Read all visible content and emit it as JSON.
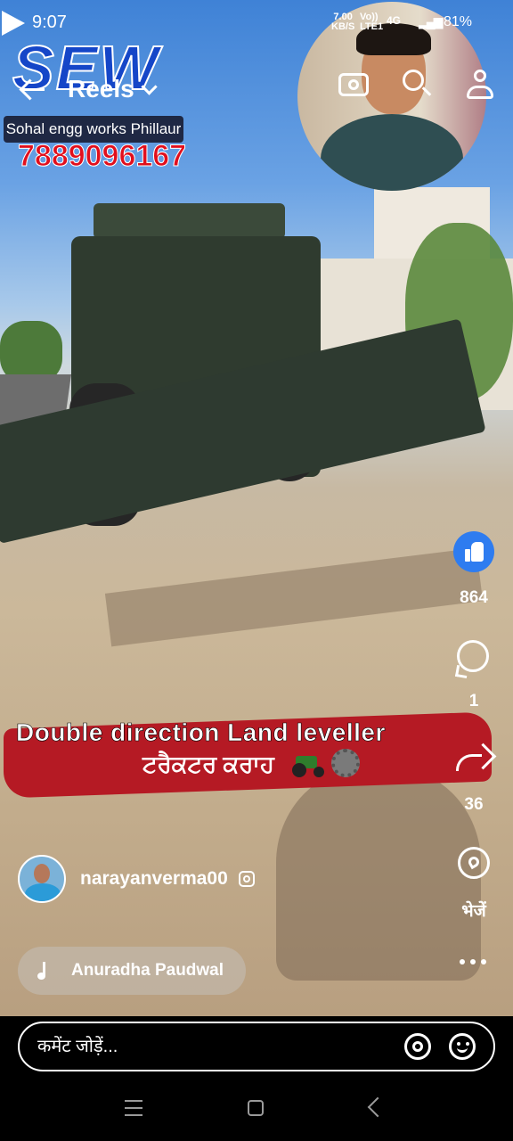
{
  "status_bar": {
    "time": "9:07",
    "net_rate_top": "7.00",
    "net_rate_bottom": "KB/S",
    "volte_top": "Vo))",
    "volte_bottom": "LTE1",
    "network": "4G",
    "battery": "81%",
    "overlay_digit": "2"
  },
  "header": {
    "title": "Reels"
  },
  "watermark": {
    "logo": "SEW",
    "company": "Sohal engg works Phillaur",
    "phone": "7889096167"
  },
  "caption": {
    "line1": "Double direction Land leveller",
    "line2": "ਟਰੈਕਟਰ ਕਰਾਹ"
  },
  "actions": {
    "likes": "864",
    "comments": "1",
    "shares": "36",
    "send_label": "भेजें"
  },
  "owner": {
    "username": "narayanverma00"
  },
  "music": {
    "title": "Anuradha Paudwal"
  },
  "comment": {
    "placeholder": "कमेंट जोड़ें..."
  },
  "colors": {
    "like_blue": "#2e7cf0",
    "caption_red": "#b51a24",
    "logo_blue": "#1546c8",
    "phone_red": "#e10f1d"
  }
}
